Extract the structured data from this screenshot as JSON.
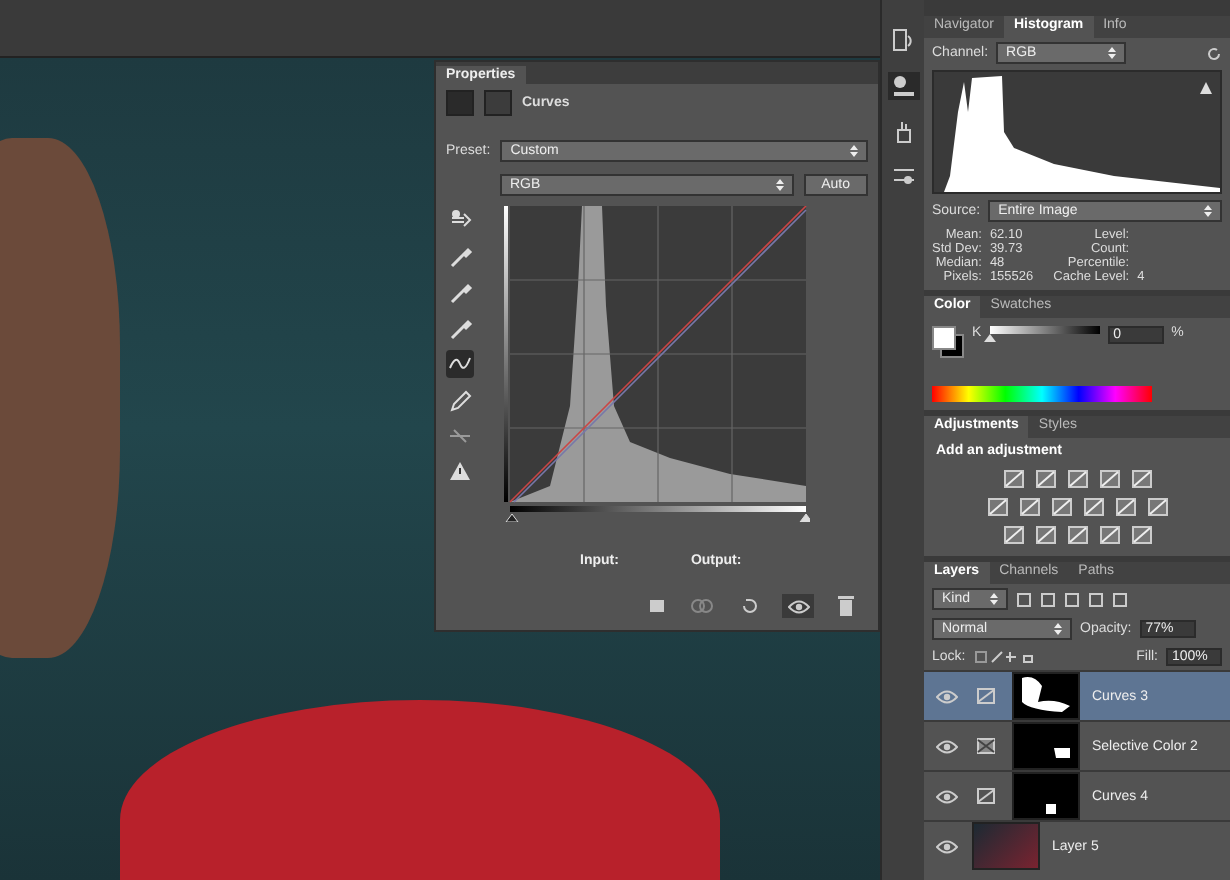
{
  "properties": {
    "title": "Properties",
    "type_label": "Curves",
    "preset_label": "Preset:",
    "preset": "Custom",
    "channel": "RGB",
    "auto_button": "Auto",
    "tools": [
      {
        "kind": "target",
        "selected": false
      },
      {
        "kind": "eyedropper",
        "selected": false
      },
      {
        "kind": "eyedropper",
        "selected": false
      },
      {
        "kind": "eyedropper",
        "selected": false
      },
      {
        "kind": "curve",
        "selected": true
      },
      {
        "kind": "pencil",
        "selected": false
      },
      {
        "kind": "smooth",
        "selected": false
      },
      {
        "kind": "warning",
        "selected": false
      }
    ],
    "sliders": [
      {
        "level": 0
      },
      {
        "level": 1
      }
    ],
    "input_label": "Input:",
    "output_label": "Output:",
    "visibility_on": true
  },
  "histogram_panel": {
    "tabs": [
      {
        "label": "Navigator",
        "selected": false
      },
      {
        "label": "Histogram",
        "selected": true
      },
      {
        "label": "Info",
        "selected": false
      }
    ],
    "channel_label": "Channel:",
    "channel": "RGB",
    "source_label": "Source:",
    "source": "Entire Image",
    "stats_left": [
      {
        "label": "Mean:",
        "value": "62.10"
      },
      {
        "label": "Std Dev:",
        "value": "39.73"
      },
      {
        "label": "Median:",
        "value": "48"
      },
      {
        "label": "Pixels:",
        "value": "155526"
      }
    ],
    "stats_right": [
      {
        "label": "Level:"
      },
      {
        "label": "Count:"
      },
      {
        "label": "Percentile:"
      },
      {
        "label": "Cache Level:",
        "value": "4"
      }
    ]
  },
  "color_panel": {
    "tabs": [
      {
        "label": "Color",
        "selected": true
      },
      {
        "label": "Swatches",
        "selected": false
      }
    ],
    "slider_label": "K",
    "level": 0,
    "value": "0",
    "unit": "%"
  },
  "adjustments_panel": {
    "tabs": [
      {
        "label": "Adjustments",
        "selected": true
      },
      {
        "label": "Styles",
        "selected": false
      }
    ],
    "heading": "Add an adjustment"
  },
  "layers_panel": {
    "tabs": [
      {
        "label": "Layers",
        "selected": true
      },
      {
        "label": "Channels",
        "selected": false
      },
      {
        "label": "Paths",
        "selected": false
      }
    ],
    "filter": "Kind",
    "blend_mode": "Normal",
    "opacity_label": "Opacity:",
    "opacity": "77%",
    "lock_label": "Lock:",
    "fill_label": "Fill:",
    "fill": "100%",
    "layers": [
      {
        "name": "Curves 3",
        "kind": "curves",
        "selected": true,
        "visible": true
      },
      {
        "name": "Selective Color 2",
        "kind": "selective-color",
        "selected": false,
        "visible": true
      },
      {
        "name": "Curves 4",
        "kind": "curves",
        "selected": false,
        "visible": true
      },
      {
        "name": "Layer 5",
        "kind": "pixel",
        "selected": false,
        "visible": true
      }
    ]
  }
}
